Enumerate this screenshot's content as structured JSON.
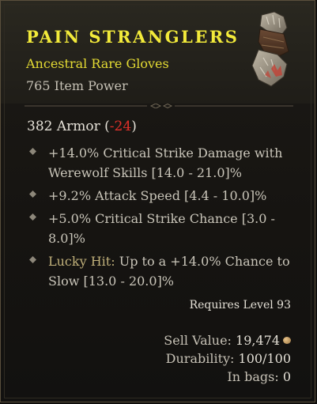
{
  "item": {
    "name": "PAIN STRANGLERS",
    "type": "Ancestral Rare Gloves",
    "power": "765 Item Power",
    "image_icon": "gloves-icon"
  },
  "armor": {
    "value": "382 Armor",
    "delta": "-24",
    "open": "(",
    "close": ")"
  },
  "affixes": [
    {
      "text": "+14.0% Critical Strike Damage with Werewolf Skills [14.0 - 21.0]%"
    },
    {
      "text": "+9.2% Attack Speed [4.4 - 10.0]%"
    },
    {
      "text": "+5.0% Critical Strike Chance [3.0 - 8.0]%"
    },
    {
      "lucky_label": "Lucky Hit:",
      "text": "Up to a +14.0% Chance to Slow [13.0 - 20.0]%"
    }
  ],
  "requirement": "Requires Level 93",
  "footer": {
    "sell_label": "Sell Value:",
    "sell_value": "19,474",
    "durability_label": "Durability:",
    "durability_value": "100/100",
    "bags_label": "In bags:",
    "bags_value": "0"
  },
  "colors": {
    "rare": "#f2ea3a",
    "negative": "#e0302a",
    "affix_text": "#c9c5b9",
    "lucky_hit": "#c0b07a"
  }
}
